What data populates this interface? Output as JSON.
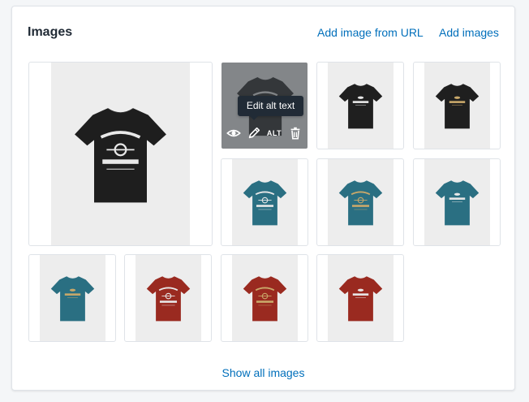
{
  "section": {
    "title": "Images",
    "add_from_url": "Add image from URL",
    "add_images": "Add images",
    "show_all": "Show all images"
  },
  "hover_actions": {
    "alt_label": "ALT",
    "tooltip": "Edit alt text"
  },
  "images": [
    {
      "color": "#1e1e1e",
      "print": "JUST RIDE / CAFE RACER",
      "print_color": "#e8e8e8"
    },
    {
      "color": "#1e1e1e",
      "print": "JUST RIDE / CAFE RACER",
      "print_color": "#e8e8e8"
    },
    {
      "color": "#1f1f1f",
      "print": "T-SHIRT BACK",
      "print_color": "#e8e8e8"
    },
    {
      "color": "#1f1f1f",
      "print": "T-SHIRT BACK",
      "print_color": "#c9a86a"
    },
    {
      "color": "#2a6f82",
      "print": "JUST RIDE / CAFE RACER",
      "print_color": "#e8e8e8"
    },
    {
      "color": "#2a6f82",
      "print": "JUST RIDE / CAFE RACER",
      "print_color": "#c9a86a"
    },
    {
      "color": "#2a6f82",
      "print": "T-SHIRT BACK",
      "print_color": "#e8e8e8"
    },
    {
      "color": "#2a6f82",
      "print": "T-SHIRT BACK",
      "print_color": "#c9a86a"
    },
    {
      "color": "#9a2a20",
      "print": "JUST RIDE / CAFE RACER",
      "print_color": "#e8e8e8"
    },
    {
      "color": "#9a2a20",
      "print": "JUST RIDE / CAFE RACER",
      "print_color": "#c9a86a"
    },
    {
      "color": "#9a2a20",
      "print": "T-SHIRT BACK",
      "print_color": "#e8e8e8"
    }
  ],
  "colors": {
    "link": "#006fbb",
    "border": "#dfe3e8",
    "overlay": "rgba(66,71,76,0.62)",
    "tooltip_bg": "#212b36"
  }
}
